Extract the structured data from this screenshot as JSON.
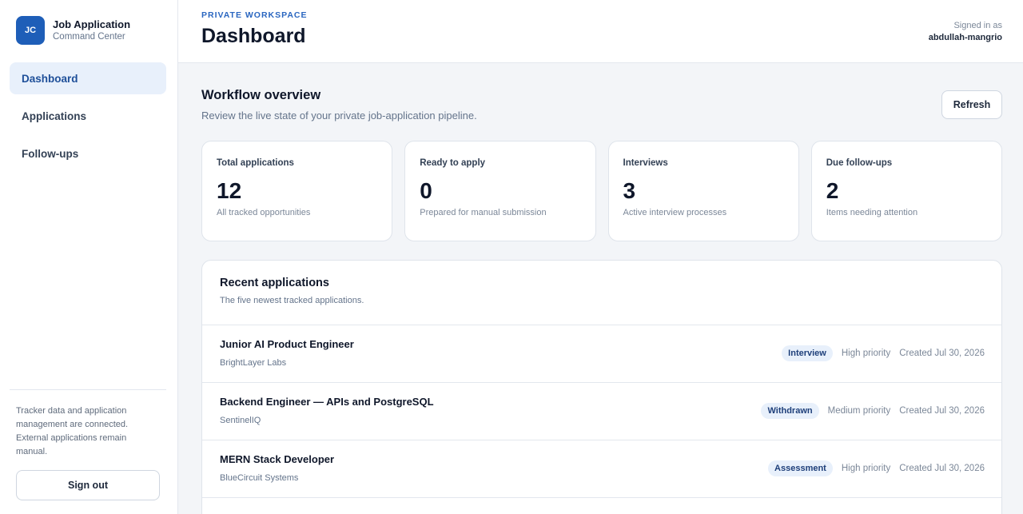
{
  "brand": {
    "initials": "JC",
    "title": "Job Application",
    "subtitle": "Command Center"
  },
  "nav": [
    {
      "label": "Dashboard",
      "active": true
    },
    {
      "label": "Applications",
      "active": false
    },
    {
      "label": "Follow-ups",
      "active": false
    }
  ],
  "sidebar_note": "Tracker data and application management are connected. External applications remain manual.",
  "signout_label": "Sign out",
  "header": {
    "eyebrow": "PRIVATE WORKSPACE",
    "title": "Dashboard",
    "signed_in_label": "Signed in as",
    "username": "abdullah-mangrio"
  },
  "overview": {
    "title": "Workflow overview",
    "subtitle": "Review the live state of your private job-application pipeline.",
    "refresh_label": "Refresh"
  },
  "stats": [
    {
      "label": "Total applications",
      "value": "12",
      "desc": "All tracked opportunities"
    },
    {
      "label": "Ready to apply",
      "value": "0",
      "desc": "Prepared for manual submission"
    },
    {
      "label": "Interviews",
      "value": "3",
      "desc": "Active interview processes"
    },
    {
      "label": "Due follow-ups",
      "value": "2",
      "desc": "Items needing attention"
    }
  ],
  "recent": {
    "title": "Recent applications",
    "subtitle": "The five newest tracked applications.",
    "rows": [
      {
        "title": "Junior AI Product Engineer",
        "company": "BrightLayer Labs",
        "status": "Interview",
        "priority": "High priority",
        "created": "Created Jul 30, 2026"
      },
      {
        "title": "Backend Engineer — APIs and PostgreSQL",
        "company": "SentinelIQ",
        "status": "Withdrawn",
        "priority": "Medium priority",
        "created": "Created Jul 30, 2026"
      },
      {
        "title": "MERN Stack Developer",
        "company": "BlueCircuit Systems",
        "status": "Assessment",
        "priority": "High priority",
        "created": "Created Jul 30, 2026"
      }
    ]
  }
}
